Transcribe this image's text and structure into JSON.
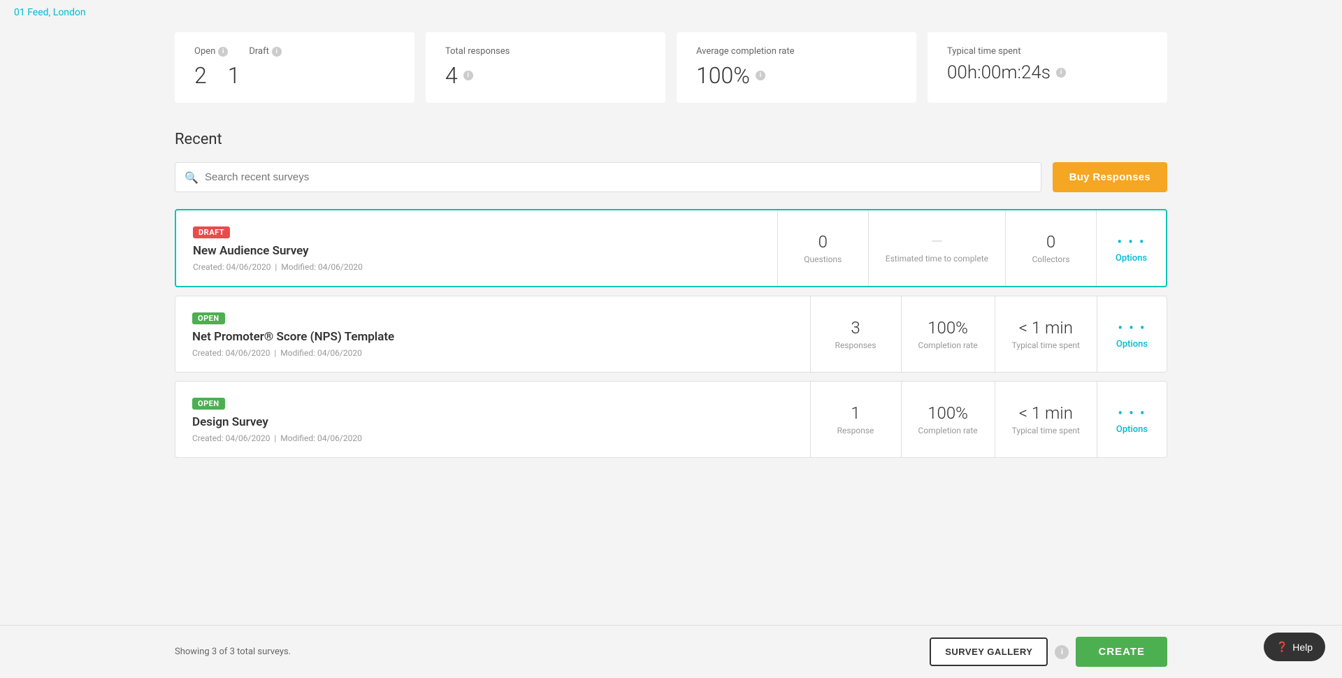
{
  "topLink": {
    "label": "01 Feed, London",
    "href": "#"
  },
  "stats": {
    "open": {
      "label": "Open",
      "value": "2"
    },
    "draft": {
      "label": "Draft",
      "value": "1"
    },
    "totalResponses": {
      "label": "Total responses",
      "value": "4"
    },
    "avgCompletionRate": {
      "label": "Average completion rate",
      "value": "100%"
    },
    "typicalTimeSpent": {
      "label": "Typical time spent",
      "value": "00h:00m:24s"
    }
  },
  "recent": {
    "title": "Recent",
    "search": {
      "placeholder": "Search recent surveys"
    },
    "buyResponsesBtn": "Buy Responses",
    "surveys": [
      {
        "status": "DRAFT",
        "statusType": "draft",
        "title": "New Audience Survey",
        "created": "04/06/2020",
        "modified": "04/06/2020",
        "stat1Value": "0",
        "stat1Label": "Questions",
        "stat2Value": "—",
        "stat2Label": "Estimated time to complete",
        "stat3Value": "0",
        "stat3Label": "Collectors",
        "optionsLabel": "Options"
      },
      {
        "status": "OPEN",
        "statusType": "open",
        "title": "Net Promoter® Score (NPS) Template",
        "created": "04/06/2020",
        "modified": "04/06/2020",
        "stat1Value": "3",
        "stat1Label": "Responses",
        "stat2Value": "100%",
        "stat2Label": "Completion rate",
        "stat3Value": "< 1 min",
        "stat3Label": "Typical time spent",
        "optionsLabel": "Options"
      },
      {
        "status": "OPEN",
        "statusType": "open",
        "title": "Design Survey",
        "created": "04/06/2020",
        "modified": "04/06/2020",
        "stat1Value": "1",
        "stat1Label": "Response",
        "stat2Value": "100%",
        "stat2Label": "Completion rate",
        "stat3Value": "< 1 min",
        "stat3Label": "Typical time spent",
        "optionsLabel": "Options"
      }
    ]
  },
  "footer": {
    "showingText": "Showing 3 of 3 total surveys.",
    "surveyGalleryBtn": "SURVEY GALLERY",
    "createBtn": "CREATE"
  },
  "help": {
    "label": "Help"
  }
}
